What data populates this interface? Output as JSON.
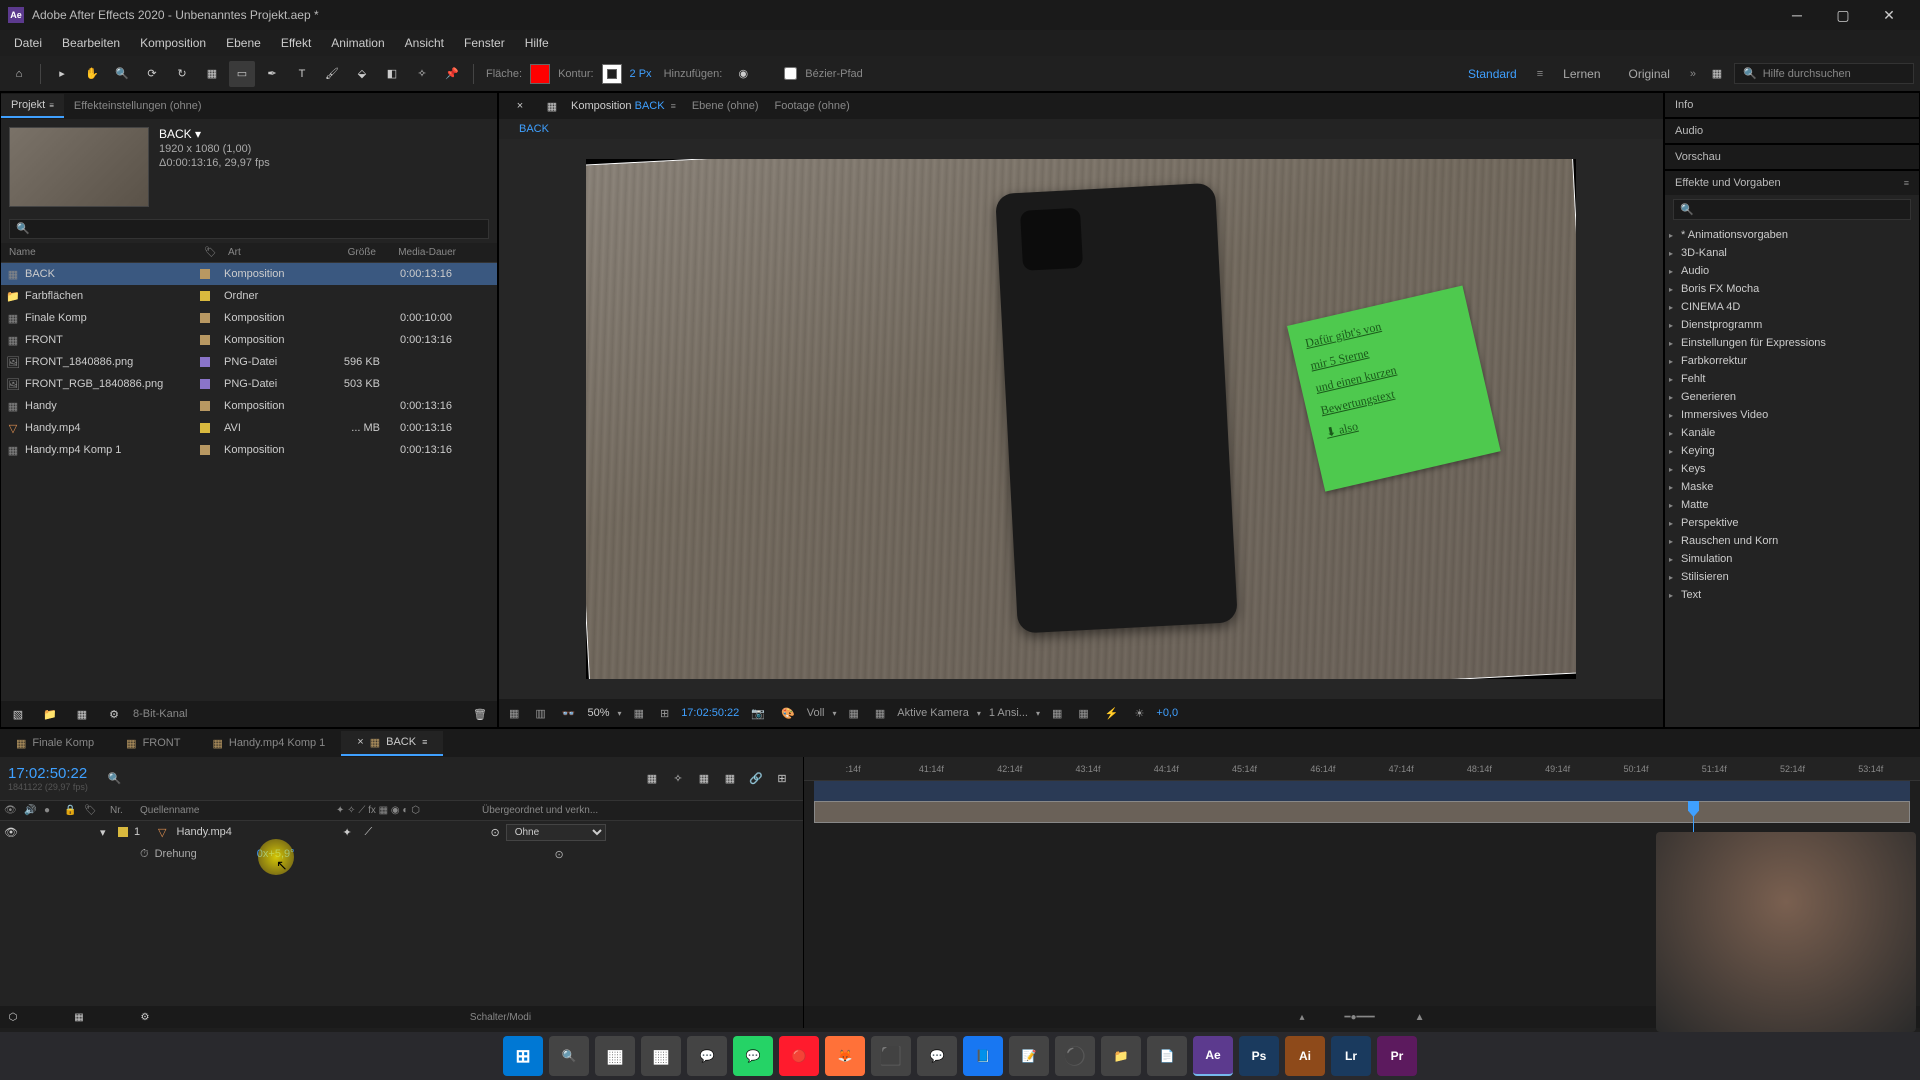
{
  "titlebar": {
    "app_short": "Ae",
    "title": "Adobe After Effects 2020 - Unbenanntes Projekt.aep *"
  },
  "menubar": [
    "Datei",
    "Bearbeiten",
    "Komposition",
    "Ebene",
    "Effekt",
    "Animation",
    "Ansicht",
    "Fenster",
    "Hilfe"
  ],
  "toolbar": {
    "fill_label": "Fläche:",
    "stroke_label": "Kontur:",
    "stroke_width": "2 Px",
    "add_label": "Hinzufügen:",
    "bezier_label": "Bézier-Pfad",
    "workspace": "Standard",
    "learn": "Lernen",
    "original": "Original",
    "search_placeholder": "Hilfe durchsuchen"
  },
  "project_panel": {
    "tab_project": "Projekt",
    "tab_effects": "Effekteinstellungen (ohne)",
    "comp_name": "BACK",
    "comp_dims": "1920 x 1080 (1,00)",
    "comp_dur": "Δ0:00:13:16, 29,97 fps",
    "headers": {
      "name": "Name",
      "type": "Art",
      "size": "Größe",
      "dur": "Media-Dauer"
    },
    "items": [
      {
        "name": "BACK",
        "type": "Komposition",
        "size": "",
        "dur": "0:00:13:16",
        "icon": "comp",
        "tag": "#b89862",
        "selected": true
      },
      {
        "name": "Farbflächen",
        "type": "Ordner",
        "size": "",
        "dur": "",
        "icon": "folder",
        "tag": "#d9b93e"
      },
      {
        "name": "Finale Komp",
        "type": "Komposition",
        "size": "",
        "dur": "0:00:10:00",
        "icon": "comp",
        "tag": "#b89862"
      },
      {
        "name": "FRONT",
        "type": "Komposition",
        "size": "",
        "dur": "0:00:13:16",
        "icon": "comp",
        "tag": "#b89862"
      },
      {
        "name": "FRONT_1840886.png",
        "type": "PNG-Datei",
        "size": "596 KB",
        "dur": "",
        "icon": "image",
        "tag": "#8a74c9"
      },
      {
        "name": "FRONT_RGB_1840886.png",
        "type": "PNG-Datei",
        "size": "503 KB",
        "dur": "",
        "icon": "image",
        "tag": "#8a74c9"
      },
      {
        "name": "Handy",
        "type": "Komposition",
        "size": "",
        "dur": "0:00:13:16",
        "icon": "comp",
        "tag": "#b89862"
      },
      {
        "name": "Handy.mp4",
        "type": "AVI",
        "size": "... MB",
        "dur": "0:00:13:16",
        "icon": "video",
        "tag": "#d9b93e"
      },
      {
        "name": "Handy.mp4 Komp 1",
        "type": "Komposition",
        "size": "",
        "dur": "0:00:13:16",
        "icon": "comp",
        "tag": "#b89862"
      }
    ],
    "footer_depth": "8-Bit-Kanal"
  },
  "comp_panel": {
    "tab_comp_prefix": "Komposition",
    "tab_comp_name": "BACK",
    "tab_layer": "Ebene (ohne)",
    "tab_footage": "Footage (ohne)",
    "breadcrumb": "BACK",
    "footer": {
      "zoom": "50%",
      "time": "17:02:50:22",
      "quality": "Voll",
      "camera": "Aktive Kamera",
      "views": "1 Ansi...",
      "exposure": "+0,0"
    }
  },
  "right": {
    "info": "Info",
    "audio": "Audio",
    "preview": "Vorschau",
    "effects_title": "Effekte und Vorgaben",
    "effects": [
      "* Animationsvorgaben",
      "3D-Kanal",
      "Audio",
      "Boris FX Mocha",
      "CINEMA 4D",
      "Dienstprogramm",
      "Einstellungen für Expressions",
      "Farbkorrektur",
      "Fehlt",
      "Generieren",
      "Immersives Video",
      "Kanäle",
      "Keying",
      "Keys",
      "Maske",
      "Matte",
      "Perspektive",
      "Rauschen und Korn",
      "Simulation",
      "Stilisieren",
      "Text"
    ]
  },
  "timeline": {
    "tabs": [
      {
        "label": "Finale Komp",
        "active": false
      },
      {
        "label": "FRONT",
        "active": false
      },
      {
        "label": "Handy.mp4 Komp 1",
        "active": false
      },
      {
        "label": "BACK",
        "active": true
      }
    ],
    "current_time": "17:02:50:22",
    "sub_time": "1841122 (29,97 fps)",
    "col_nr": "Nr.",
    "col_source": "Quellenname",
    "col_parent": "Übergeordnet und verkn...",
    "layer": {
      "num": "1",
      "name": "Handy.mp4",
      "parent": "Ohne"
    },
    "prop": {
      "name": "Drehung",
      "value": "0x+5,9°"
    },
    "ruler": [
      ":14f",
      "41:14f",
      "42:14f",
      "43:14f",
      "44:14f",
      "45:14f",
      "46:14f",
      "47:14f",
      "48:14f",
      "49:14f",
      "50:14f",
      "51:14f",
      "52:14f",
      "53:14f"
    ],
    "footer_toggle": "Schalter/Modi"
  },
  "sticky_lines": [
    "Dafür gibt's von",
    "mir 5 Sterne",
    "und einen kurzen",
    "Bewertungstext",
    "⬇ also"
  ],
  "taskbar_apps": [
    "start",
    "search",
    "tasks",
    "widgets",
    "teams",
    "whatsapp",
    "opera",
    "firefox",
    "app1",
    "messenger",
    "facebook",
    "sticky",
    "obs",
    "explorer",
    "notepad",
    "ae",
    "ps",
    "ai",
    "lr",
    "pr"
  ]
}
